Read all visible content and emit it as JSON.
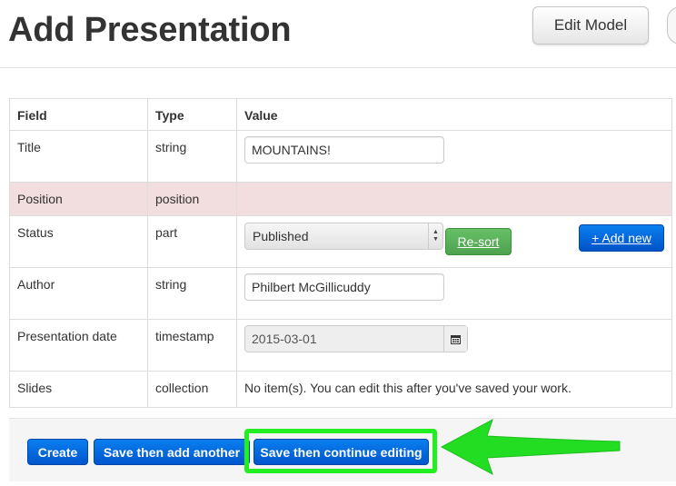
{
  "header": {
    "title": "Add Presentation",
    "edit_model_label": "Edit Model"
  },
  "table": {
    "columns": [
      "Field",
      "Type",
      "Value"
    ],
    "rows": [
      {
        "field": "Title",
        "type": "string",
        "value": "MOUNTAINS!"
      },
      {
        "field": "Position",
        "type": "position",
        "value": ""
      },
      {
        "field": "Status",
        "type": "part",
        "value": "Published"
      },
      {
        "field": "Author",
        "type": "string",
        "value": "Philbert McGillicuddy"
      },
      {
        "field": "Presentation date",
        "type": "timestamp",
        "value": "2015-03-01"
      },
      {
        "field": "Slides",
        "type": "collection",
        "value": "No item(s). You can edit this after you've saved your work."
      }
    ],
    "resort_label": "Re-sort",
    "add_new_label": "+ Add new",
    "calendar_icon": "calendar-icon",
    "select_arrows_icon": "updown-arrows-icon"
  },
  "actions": {
    "create_label": "Create",
    "save_add_another_label": "Save then add another",
    "save_continue_label": "Save then continue editing"
  },
  "annotation": {
    "highlight_color": "#22ee22",
    "arrow_color": "#22dd22"
  },
  "colors": {
    "primary_button": "#0a6fe6",
    "success_button": "#5cb85c",
    "error_row": "#f2dede"
  }
}
